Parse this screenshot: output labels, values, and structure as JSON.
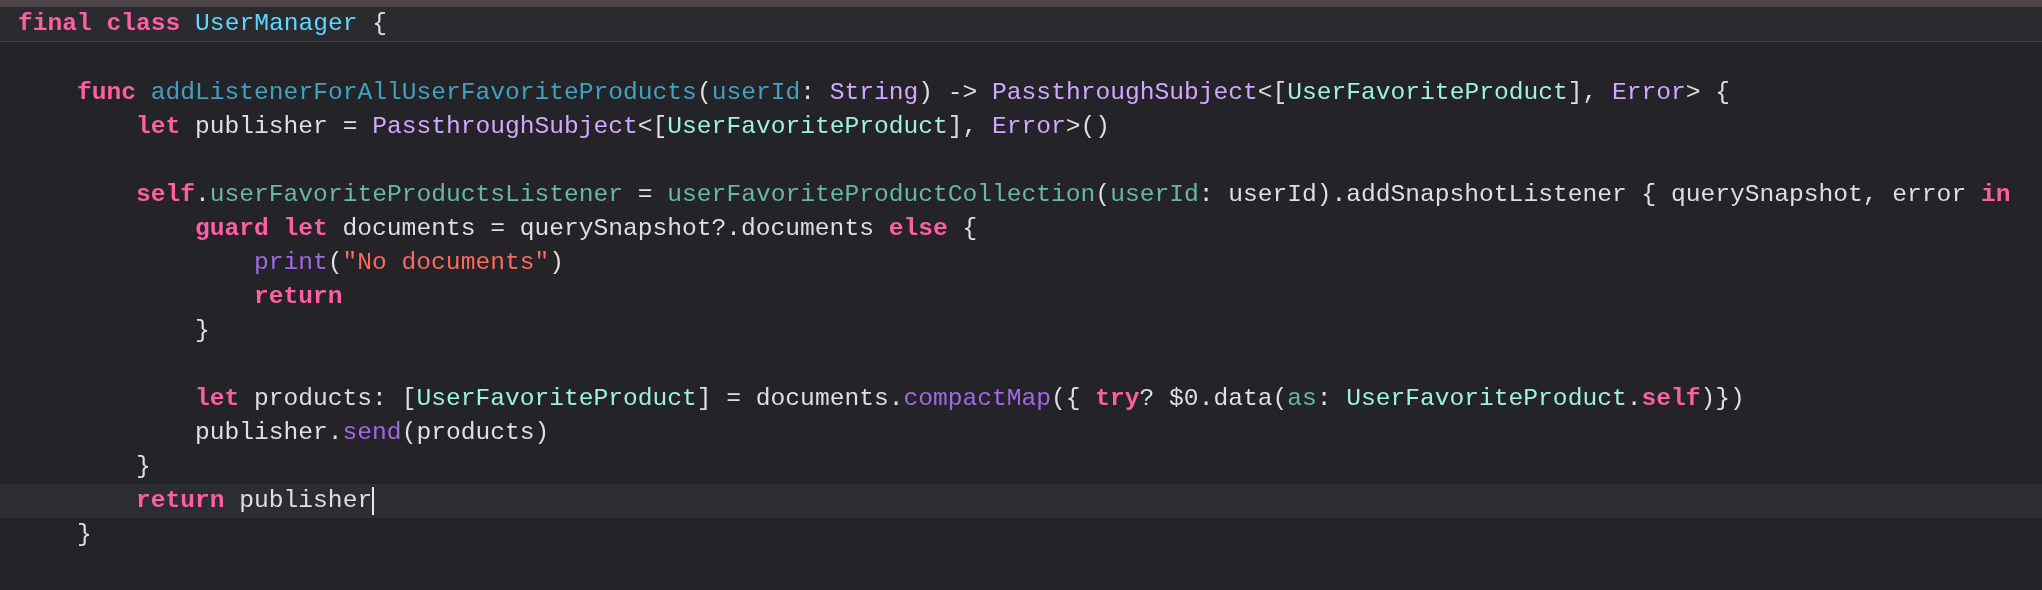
{
  "editor": {
    "sticky_header": [
      {
        "text": "final class ",
        "kind": "keyword"
      },
      {
        "text": "UserManager",
        "kind": "decl_type"
      },
      {
        "text": " {",
        "kind": "plain"
      }
    ],
    "lines": [
      {
        "current": false
      },
      {
        "current": false,
        "tokens": [
          {
            "text": "func ",
            "kind": "keyword"
          },
          {
            "text": "addListenerForAllUserFavoriteProducts",
            "kind": "decl_func"
          },
          {
            "text": "(",
            "kind": "plain"
          },
          {
            "text": "userId",
            "kind": "decl_func"
          },
          {
            "text": ": ",
            "kind": "plain"
          },
          {
            "text": "String",
            "kind": "system_type"
          },
          {
            "text": ") -> ",
            "kind": "plain"
          },
          {
            "text": "PassthroughSubject",
            "kind": "system_type"
          },
          {
            "text": "<[",
            "kind": "plain"
          },
          {
            "text": "UserFavoriteProduct",
            "kind": "project_type"
          },
          {
            "text": "], ",
            "kind": "plain"
          },
          {
            "text": "Error",
            "kind": "system_type"
          },
          {
            "text": "> {",
            "kind": "plain"
          }
        ],
        "children": [
          {
            "current": false,
            "tokens": [
              {
                "text": "let",
                "kind": "keyword"
              },
              {
                "text": " publisher = ",
                "kind": "plain"
              },
              {
                "text": "PassthroughSubject",
                "kind": "system_type"
              },
              {
                "text": "<[",
                "kind": "plain"
              },
              {
                "text": "UserFavoriteProduct",
                "kind": "project_type"
              },
              {
                "text": "], ",
                "kind": "plain"
              },
              {
                "text": "Error",
                "kind": "system_type"
              },
              {
                "text": ">()",
                "kind": "plain"
              }
            ]
          },
          {
            "current": false
          },
          {
            "current": false,
            "tokens": [
              {
                "text": "self",
                "kind": "keyword"
              },
              {
                "text": ".",
                "kind": "plain"
              },
              {
                "text": "userFavoriteProductsListener",
                "kind": "project_member"
              },
              {
                "text": " = ",
                "kind": "plain"
              },
              {
                "text": "userFavoriteProductCollection",
                "kind": "project_member"
              },
              {
                "text": "(",
                "kind": "plain"
              },
              {
                "text": "userId",
                "kind": "project_member"
              },
              {
                "text": ": userId).addSnapshotListener { querySnapshot, error ",
                "kind": "plain"
              },
              {
                "text": "in",
                "kind": "keyword"
              }
            ],
            "children": [
              {
                "current": false,
                "tokens": [
                  {
                    "text": "guard let",
                    "kind": "keyword"
                  },
                  {
                    "text": " documents = querySnapshot?.documents ",
                    "kind": "plain"
                  },
                  {
                    "text": "else",
                    "kind": "keyword"
                  },
                  {
                    "text": " {",
                    "kind": "plain"
                  }
                ],
                "children": [
                  {
                    "current": false,
                    "tokens": [
                      {
                        "text": "print",
                        "kind": "system_func"
                      },
                      {
                        "text": "(",
                        "kind": "plain"
                      },
                      {
                        "text": "\"No documents\"",
                        "kind": "string"
                      },
                      {
                        "text": ")",
                        "kind": "plain"
                      }
                    ]
                  },
                  {
                    "current": false,
                    "tokens": [
                      {
                        "text": "return",
                        "kind": "keyword"
                      }
                    ]
                  }
                ]
              },
              {
                "current": false,
                "tokens": [
                  {
                    "text": "}",
                    "kind": "plain"
                  }
                ]
              },
              {
                "current": false
              },
              {
                "current": false,
                "tokens": [
                  {
                    "text": "let",
                    "kind": "keyword"
                  },
                  {
                    "text": " products: [",
                    "kind": "plain"
                  },
                  {
                    "text": "UserFavoriteProduct",
                    "kind": "project_type"
                  },
                  {
                    "text": "] = documents.",
                    "kind": "plain"
                  },
                  {
                    "text": "compactMap",
                    "kind": "system_func"
                  },
                  {
                    "text": "({ ",
                    "kind": "plain"
                  },
                  {
                    "text": "try",
                    "kind": "keyword"
                  },
                  {
                    "text": "? $0.data(",
                    "kind": "plain"
                  },
                  {
                    "text": "as",
                    "kind": "project_member"
                  },
                  {
                    "text": ": ",
                    "kind": "plain"
                  },
                  {
                    "text": "UserFavoriteProduct",
                    "kind": "project_type"
                  },
                  {
                    "text": ".",
                    "kind": "plain"
                  },
                  {
                    "text": "self",
                    "kind": "keyword"
                  },
                  {
                    "text": ")})",
                    "kind": "plain"
                  }
                ]
              },
              {
                "current": false,
                "tokens": [
                  {
                    "text": "publisher.",
                    "kind": "plain"
                  },
                  {
                    "text": "send",
                    "kind": "system_func"
                  },
                  {
                    "text": "(products)",
                    "kind": "plain"
                  }
                ]
              }
            ]
          },
          {
            "current": false,
            "tokens": [
              {
                "text": "}",
                "kind": "plain"
              }
            ]
          },
          {
            "current": true,
            "tokens": [
              {
                "text": "return",
                "kind": "keyword"
              },
              {
                "text": " publisher",
                "kind": "plain"
              }
            ]
          }
        ]
      },
      {
        "current": false,
        "tokens": [
          {
            "text": "}",
            "kind": "plain"
          }
        ]
      },
      {
        "current": false
      }
    ]
  }
}
